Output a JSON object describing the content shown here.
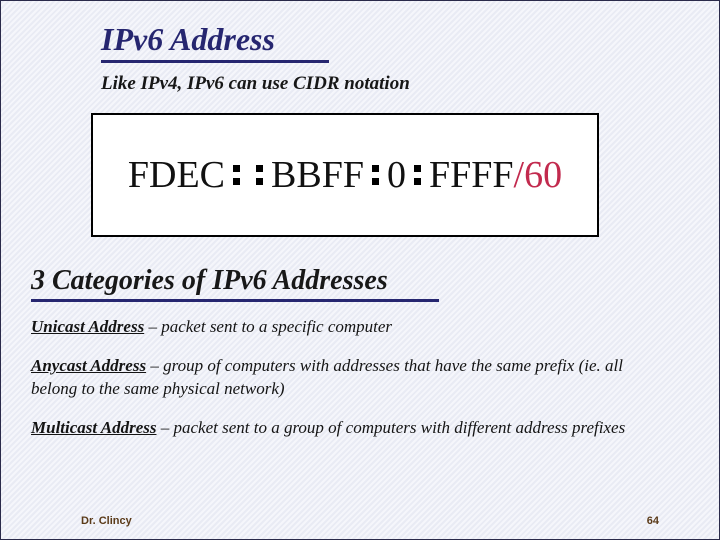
{
  "title": "IPv6 Address",
  "subtitle": "Like IPv4, IPv6 can use CIDR notation",
  "address": {
    "g1": "FDEC",
    "g2": "BBFF",
    "g3": "0",
    "g4": "FFFF",
    "cidr": "/60"
  },
  "categories_heading": "3 Categories of IPv6 Addresses",
  "cats": [
    {
      "term": "Unicast Address",
      "rest": " – packet sent to a specific computer"
    },
    {
      "term": "Anycast Address",
      "rest": " – group of computers with addresses that have the same prefix (ie. all belong to the same physical network)"
    },
    {
      "term": "Multicast Address",
      "rest": " – packet sent to a group of computers with different address prefixes"
    }
  ],
  "footer": {
    "author": "Dr. Clincy",
    "page": "64"
  }
}
